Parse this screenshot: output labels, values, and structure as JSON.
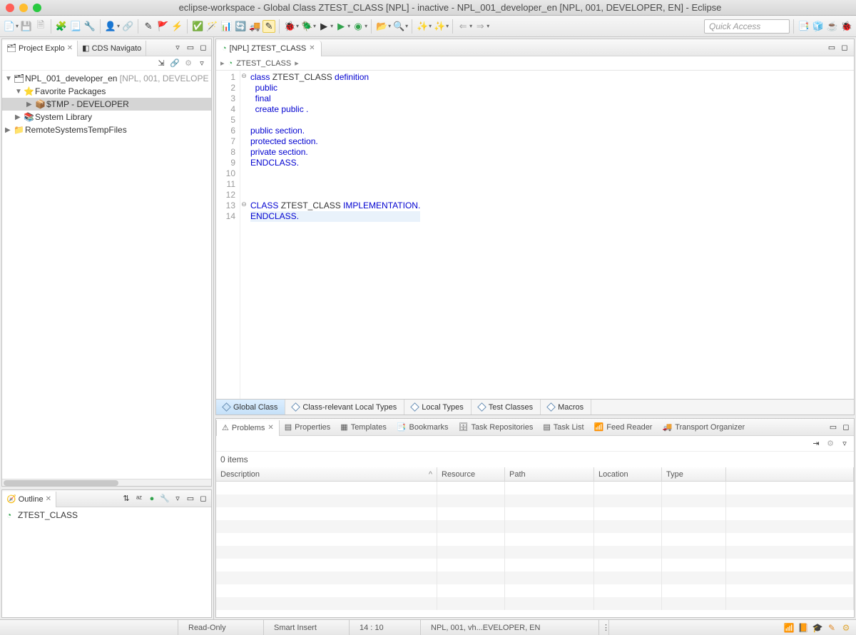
{
  "title": "eclipse-workspace - Global Class ZTEST_CLASS [NPL] - inactive - NPL_001_developer_en [NPL, 001, DEVELOPER, EN] - Eclipse",
  "quick_access_placeholder": "Quick Access",
  "left": {
    "tab_explorer": "Project Explo",
    "tab_cds": "CDS Navigato",
    "project_root": "NPL_001_developer_en",
    "project_root_suffix": "[NPL, 001, DEVELOPE",
    "fav": "Favorite Packages",
    "tmp": "$TMP - DEVELOPER",
    "syslib": "System Library",
    "remote": "RemoteSystemsTempFiles"
  },
  "outline": {
    "title": "Outline",
    "item": "ZTEST_CLASS"
  },
  "editor": {
    "tab": "[NPL] ZTEST_CLASS",
    "crumb1": "ZTEST_CLASS",
    "bottom_tabs": [
      "Global Class",
      "Class-relevant Local Types",
      "Local Types",
      "Test Classes",
      "Macros"
    ],
    "code": [
      {
        "n": 1,
        "fold": "⊖",
        "tokens": [
          {
            "t": "class ",
            "k": 1
          },
          {
            "t": "ZTEST_CLASS ",
            "k": 0
          },
          {
            "t": "definition",
            "k": 1
          }
        ]
      },
      {
        "n": 2,
        "tokens": [
          {
            "t": "  public",
            "k": 1
          }
        ]
      },
      {
        "n": 3,
        "tokens": [
          {
            "t": "  final",
            "k": 1
          }
        ]
      },
      {
        "n": 4,
        "tokens": [
          {
            "t": "  create public .",
            "k": 1
          }
        ]
      },
      {
        "n": 5,
        "tokens": [
          {
            "t": "",
            "k": 0
          }
        ]
      },
      {
        "n": 6,
        "tokens": [
          {
            "t": "public section.",
            "k": 1
          }
        ]
      },
      {
        "n": 7,
        "tokens": [
          {
            "t": "protected section.",
            "k": 1
          }
        ]
      },
      {
        "n": 8,
        "tokens": [
          {
            "t": "private section.",
            "k": 1
          }
        ]
      },
      {
        "n": 9,
        "tokens": [
          {
            "t": "ENDCLASS.",
            "k": 1
          }
        ]
      },
      {
        "n": 10,
        "tokens": [
          {
            "t": "",
            "k": 0
          }
        ]
      },
      {
        "n": 11,
        "tokens": [
          {
            "t": "",
            "k": 0
          }
        ]
      },
      {
        "n": 12,
        "tokens": [
          {
            "t": "",
            "k": 0
          }
        ]
      },
      {
        "n": 13,
        "fold": "⊖",
        "tokens": [
          {
            "t": "CLASS ",
            "k": 1
          },
          {
            "t": "ZTEST_CLASS ",
            "k": 0
          },
          {
            "t": "IMPLEMENTATION.",
            "k": 1
          }
        ]
      },
      {
        "n": 14,
        "cur": true,
        "tokens": [
          {
            "t": "ENDCLASS.",
            "k": 1
          }
        ]
      }
    ]
  },
  "bottom": {
    "tabs": [
      "Problems",
      "Properties",
      "Templates",
      "Bookmarks",
      "Task Repositories",
      "Task List",
      "Feed Reader",
      "Transport Organizer"
    ],
    "items_label": "0 items",
    "cols": [
      "Description",
      "Resource",
      "Path",
      "Location",
      "Type"
    ]
  },
  "status": {
    "mode": "Read-Only",
    "insert": "Smart Insert",
    "pos": "14 : 10",
    "sys": "NPL, 001, vh...EVELOPER, EN"
  }
}
